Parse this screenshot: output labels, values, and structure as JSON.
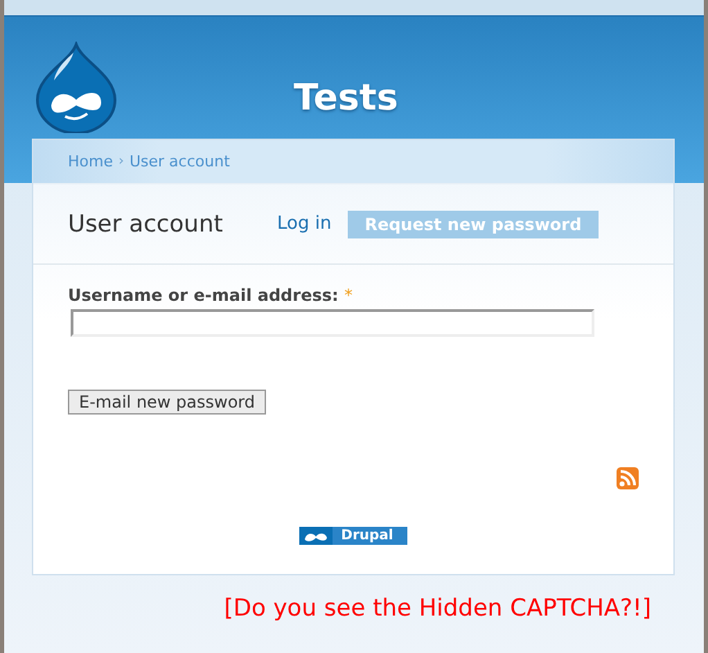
{
  "site": {
    "title": "Tests"
  },
  "breadcrumb": [
    {
      "label": "Home"
    },
    {
      "label": "User account"
    }
  ],
  "breadcrumb_separator": "›",
  "page_title": "User account",
  "tabs": [
    {
      "label": "Log in",
      "selected": false
    },
    {
      "label": "Request new password",
      "selected": true
    }
  ],
  "form": {
    "field_label": "Username or e-mail address:",
    "required_mark": "*",
    "submit": "E-mail new password"
  },
  "footer": {
    "badge": "Drupal"
  },
  "note": "[Do you see the Hidden CAPTCHA?!]"
}
